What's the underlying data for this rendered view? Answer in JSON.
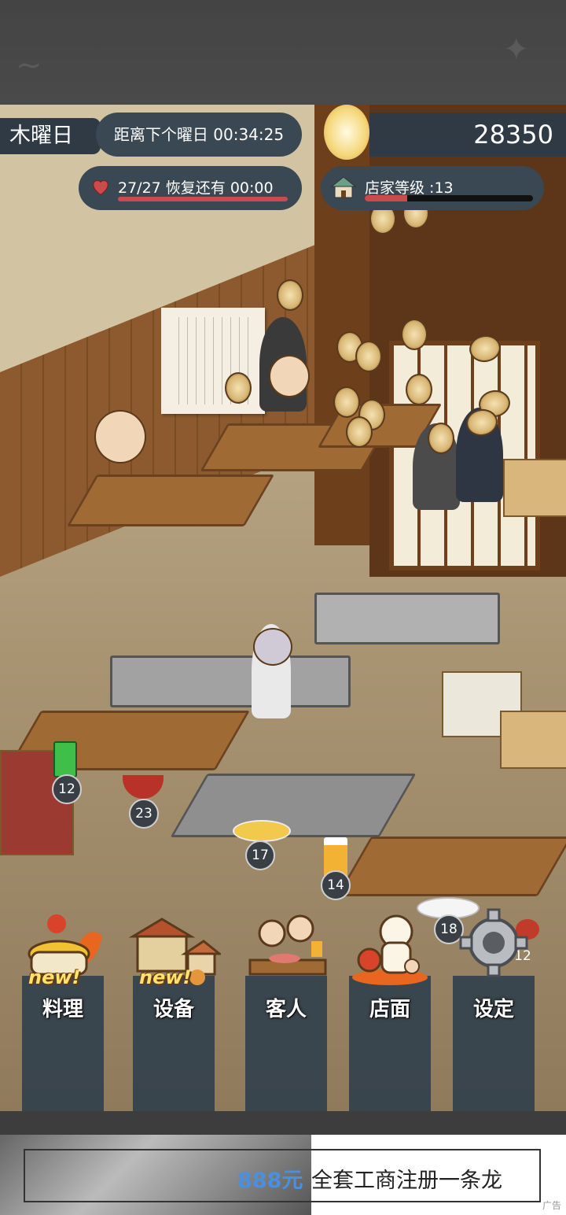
{
  "hud": {
    "day": "木曜日",
    "timer": "距离下个曜日 00:34:25",
    "money": "28350",
    "hearts": "27/27  恢复还有  00:00",
    "level": "店家等级 :13",
    "level_progress": 0.25
  },
  "counter_items": [
    {
      "name": "melon-soda",
      "count": "12"
    },
    {
      "name": "miso-bowl",
      "count": "23"
    },
    {
      "name": "fried-rice",
      "count": "17"
    },
    {
      "name": "beer",
      "count": "14"
    },
    {
      "name": "curry-rice",
      "count": "18"
    },
    {
      "name": "tomato-dish",
      "count": "12"
    }
  ],
  "menu": [
    {
      "label": "料理",
      "new": "new!",
      "icon": "cooking-pot-icon"
    },
    {
      "label": "设备",
      "new": "new!",
      "icon": "house-equipment-icon"
    },
    {
      "label": "客人",
      "icon": "customers-icon"
    },
    {
      "label": "店面",
      "icon": "lucky-cat-icon"
    },
    {
      "label": "设定",
      "icon": "gear-icon"
    }
  ],
  "ad": {
    "price": "888元",
    "text": "全套工商注册一条龙",
    "tag": "广告"
  },
  "colors": {
    "hud_bg": "#2f3a44",
    "heart": "#c94b4b",
    "new_badge": "#ffe26a"
  }
}
